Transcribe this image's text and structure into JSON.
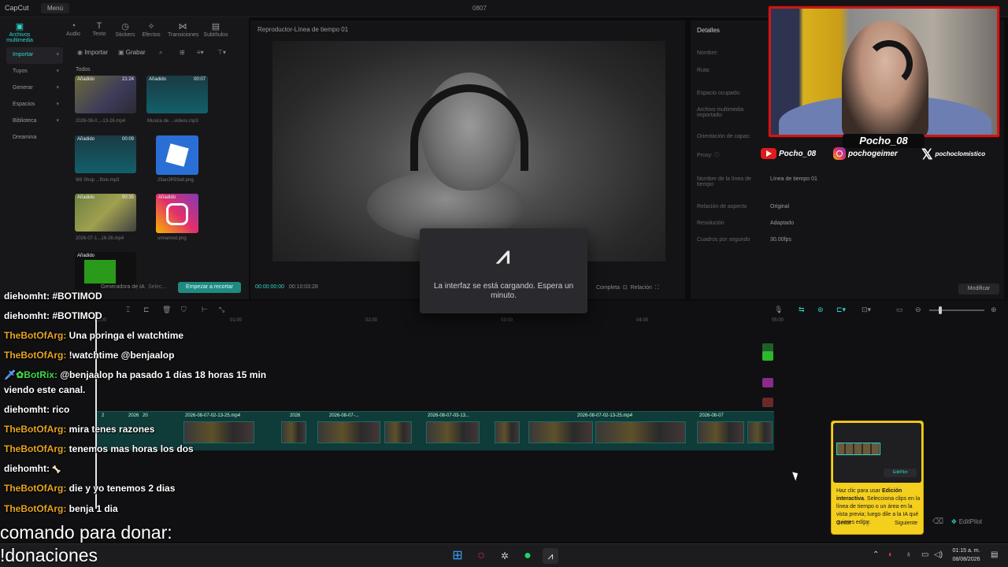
{
  "titlebar": {
    "app_name": "CapCut",
    "menu": "Menú",
    "window_title": "0807"
  },
  "tool_tabs": [
    {
      "label": "Archivos multimedia",
      "icon": "media-icon"
    },
    {
      "label": "Audio",
      "icon": "audio-icon"
    },
    {
      "label": "Texto",
      "icon": "text-icon"
    },
    {
      "label": "Stickers",
      "icon": "sticker-icon"
    },
    {
      "label": "Efectos",
      "icon": "effects-icon"
    },
    {
      "label": "Transiciones",
      "icon": "transitions-icon"
    },
    {
      "label": "Subtítulos",
      "icon": "subtitles-icon"
    }
  ],
  "sidenav": [
    {
      "label": "Importar"
    },
    {
      "label": "Tuyos"
    },
    {
      "label": "Generar"
    },
    {
      "label": "Espacios"
    },
    {
      "label": "Biblioteca"
    },
    {
      "label": "Dreamina"
    }
  ],
  "mediabar": {
    "import": "Importar",
    "record": "Grabar"
  },
  "media": {
    "section": "Todos",
    "items": [
      {
        "tag": "Añadido",
        "duration": "21:24",
        "name": "2026-08-0...-13-26.mp4"
      },
      {
        "tag": "Añadido",
        "duration": "00:07",
        "name": "Musica de ...videos.mp3"
      },
      {
        "tag": "Añadido",
        "duration": "00:09",
        "name": "Wii Shop ...floor.mp3"
      },
      {
        "tag": "",
        "duration": "",
        "name": "25an3R93oit.png"
      },
      {
        "tag": "Añadido",
        "duration": "00:35",
        "name": "2026-07-1...16-26.mp4"
      },
      {
        "tag": "Añadido",
        "duration": "",
        "name": "unnamed.png"
      },
      {
        "tag": "Añadido",
        "duration": "",
        "name": ""
      }
    ]
  },
  "media_footer": {
    "ai": "Generadora de IA",
    "select": "Selec...",
    "cut_button": "Empezar a recortar"
  },
  "player": {
    "title": "Reproductor-Línea de tiempo 01",
    "current": "00:00:00:00",
    "total": "00:10:03:28",
    "full": "Completa",
    "ratio": "Relación"
  },
  "details": {
    "title": "Detalles",
    "labels": [
      "Nombre:",
      "Ruta:",
      "Espacio ocupado:",
      "Archivo multimedia importado:",
      "Orientación de capas:",
      "Proxy: ⓘ"
    ],
    "rows": [
      {
        "label": "Nombre de la línea de tiempo",
        "value": "Línea de tiempo 01"
      },
      {
        "label": "Relación de aspecto",
        "value": "Original"
      },
      {
        "label": "Resolución",
        "value": "Adaptado"
      },
      {
        "label": "Cuadros por segundo",
        "value": "30.00fps"
      }
    ],
    "modify": "Modificar"
  },
  "overlay": {
    "streamer": "Pocho_08",
    "youtube": "Pocho_08",
    "instagram": "pochogeimer",
    "x": "pochoclomistico"
  },
  "loading": {
    "message": "La interfaz se está cargando. Espera un minuto."
  },
  "ruler": [
    "00:00",
    "01:00",
    "02:00",
    "03:00",
    "04:00",
    "05:00"
  ],
  "track": {
    "labels": [
      "2",
      "2026",
      "20",
      "2026-08-07-02-13-25.mp4",
      "2026",
      "2026-08-07-...",
      "2026-08-07-03-13...",
      "2026-08-07-02-13-25.mp4",
      "2026-08-07"
    ]
  },
  "chat": [
    {
      "user": "diehomht:",
      "msg": "#BOTIMOD",
      "color": "u1"
    },
    {
      "user": "diehomht:",
      "msg": "#BOTIMOD",
      "color": "u1"
    },
    {
      "user": "TheBotOfArg:",
      "msg": "Una poringa el watchtime",
      "color": "u2"
    },
    {
      "user": "TheBotOfArg:",
      "msg": "!watchtime @benjaalop",
      "color": "u2"
    },
    {
      "user": "BotRix:",
      "msg": "@benjaalop ha pasado 1 días 18 horas 15 min",
      "color": "u3"
    },
    {
      "user": "",
      "msg": "viendo este canal.",
      "color": "u1"
    },
    {
      "user": "diehomht:",
      "msg": "rico",
      "color": "u1"
    },
    {
      "user": "TheBotOfArg:",
      "msg": "mira tenes razones",
      "color": "u2"
    },
    {
      "user": "TheBotOfArg:",
      "msg": "tenemos mas horas los dos",
      "color": "u2"
    },
    {
      "user": "diehomht:",
      "msg": "",
      "color": "u1"
    },
    {
      "user": "TheBotOfArg:",
      "msg": "die y yo tenemos 2 dias",
      "color": "u2"
    },
    {
      "user": "TheBotOfArg:",
      "msg": "benja 1 dia",
      "color": "u2"
    }
  ],
  "donate": {
    "line1": "comando para donar:",
    "line2": "!donaciones"
  },
  "tip": {
    "text_pre": "Haz clic para usar ",
    "text_bold": "Edición interactiva",
    "text_post": ". Selecciona clips en la línea de tiempo o un área en la vista previa; luego dile a la IA qué quieres editar.",
    "skip": "Omitir",
    "next": "Siguiente",
    "preview_button": "EditPilot"
  },
  "editpilot": "EditPilot",
  "clock": {
    "time": "01:15 a. m.",
    "date": "08/08/2026"
  },
  "colors": {
    "accent": "#2fd4c8",
    "track": "#0f3b38",
    "tip": "#f5cf1e",
    "cam_border": "#c31b1b"
  }
}
